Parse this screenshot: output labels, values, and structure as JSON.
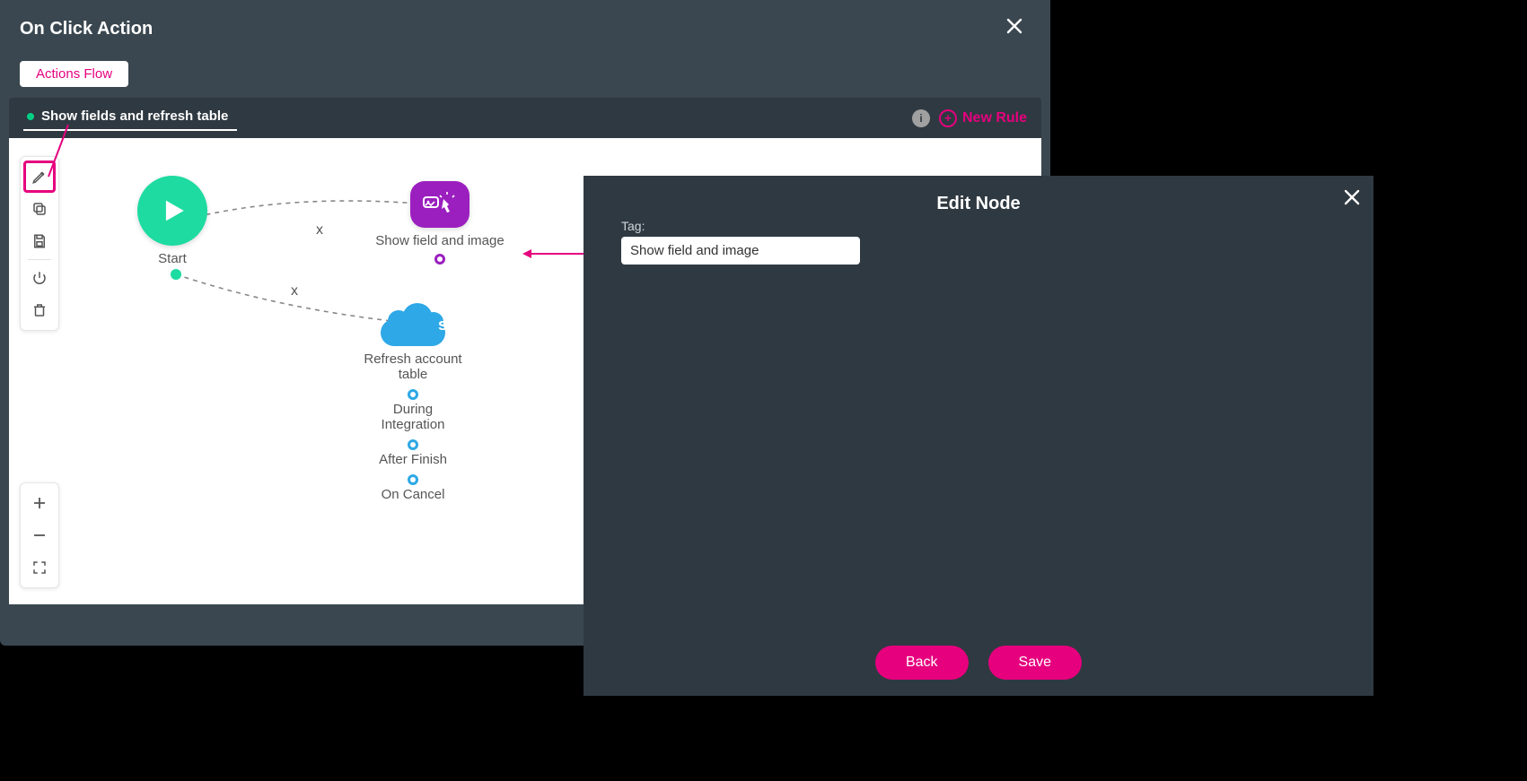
{
  "onclick": {
    "title": "On Click Action",
    "actions_flow_btn": "Actions Flow",
    "rule_tab": "Show fields and refresh table",
    "info_badge": "i",
    "new_rule": "New Rule"
  },
  "nodes": {
    "start_label": "Start",
    "show_label": "Show field and image",
    "sf_label": "Refresh account table",
    "sf_glyph": "sf",
    "chain": [
      "During Integration",
      "After Finish",
      "On Cancel"
    ],
    "edge_x": "x"
  },
  "edit": {
    "title": "Edit Node",
    "tag_label": "Tag:",
    "tag_value": "Show field and image",
    "back": "Back",
    "save": "Save"
  }
}
